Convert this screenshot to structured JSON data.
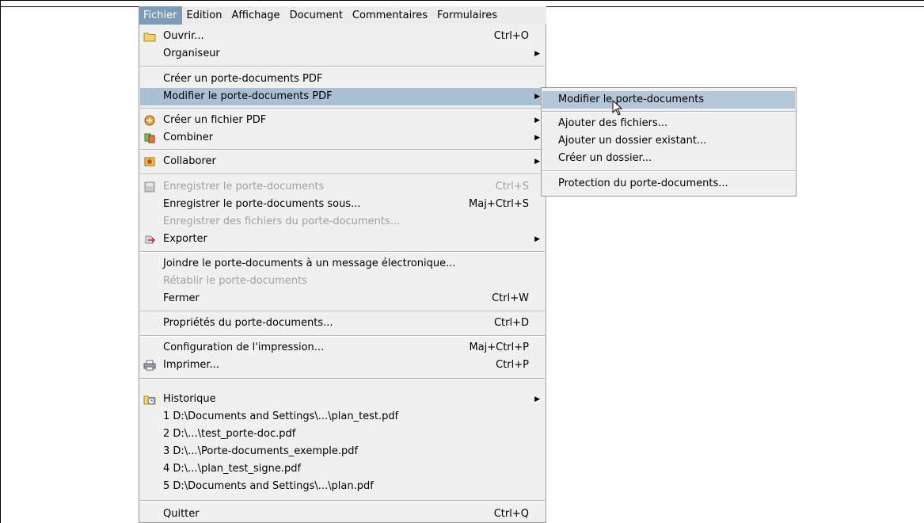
{
  "menubar": {
    "items": [
      "Fichier",
      "Edition",
      "Affichage",
      "Document",
      "Commentaires",
      "Formulaires"
    ]
  },
  "main_menu": {
    "open": {
      "label": "Ouvrir...",
      "shortcut": "Ctrl+O",
      "icon": "folder-icon"
    },
    "organizer": {
      "label": "Organiseur"
    },
    "create_portfolio": {
      "label": "Créer un porte-documents PDF"
    },
    "modify_portfolio": {
      "label": "Modifier le porte-documents PDF"
    },
    "create_pdf": {
      "label": "Créer un fichier PDF",
      "icon": "create-pdf-icon"
    },
    "combine": {
      "label": "Combiner",
      "icon": "combine-icon"
    },
    "collaborate": {
      "label": "Collaborer",
      "icon": "collaborate-icon"
    },
    "save": {
      "label": "Enregistrer le porte-documents",
      "shortcut": "Ctrl+S",
      "icon": "save-icon"
    },
    "save_as": {
      "label": "Enregistrer le porte-documents sous...",
      "shortcut": "Maj+Ctrl+S"
    },
    "save_files": {
      "label": "Enregistrer des fichiers du porte-documents..."
    },
    "export": {
      "label": "Exporter",
      "icon": "export-icon"
    },
    "attach_email": {
      "label": "Joindre le porte-documents à un message électronique..."
    },
    "restore": {
      "label": "Rétablir le porte-documents"
    },
    "close": {
      "label": "Fermer",
      "shortcut": "Ctrl+W"
    },
    "properties": {
      "label": "Propriétés du porte-documents...",
      "shortcut": "Ctrl+D"
    },
    "print_setup": {
      "label": "Configuration de l'impression...",
      "shortcut": "Maj+Ctrl+P"
    },
    "print": {
      "label": "Imprimer...",
      "shortcut": "Ctrl+P",
      "icon": "printer-icon"
    },
    "history": {
      "label": "Historique",
      "icon": "history-icon"
    },
    "recent": [
      "1 D:\\Documents and Settings\\...\\plan_test.pdf",
      "2 D:\\...\\test_porte-doc.pdf",
      "3 D:\\...\\Porte-documents_exemple.pdf",
      "4 D:\\...\\plan_test_signe.pdf",
      "5 D:\\Documents and Settings\\...\\plan.pdf"
    ],
    "quit": {
      "label": "Quitter",
      "shortcut": "Ctrl+Q"
    }
  },
  "sub_menu": {
    "items": [
      "Modifier le porte-documents",
      "Ajouter des fichiers...",
      "Ajouter un dossier existant...",
      "Créer un dossier...",
      "Protection du porte-documents..."
    ]
  },
  "colors": {
    "menubar_active": "#7d9bb4",
    "highlight": "#a9bfd3",
    "menu_bg": "#f0f0f0",
    "disabled_text": "#a0a0a0"
  }
}
